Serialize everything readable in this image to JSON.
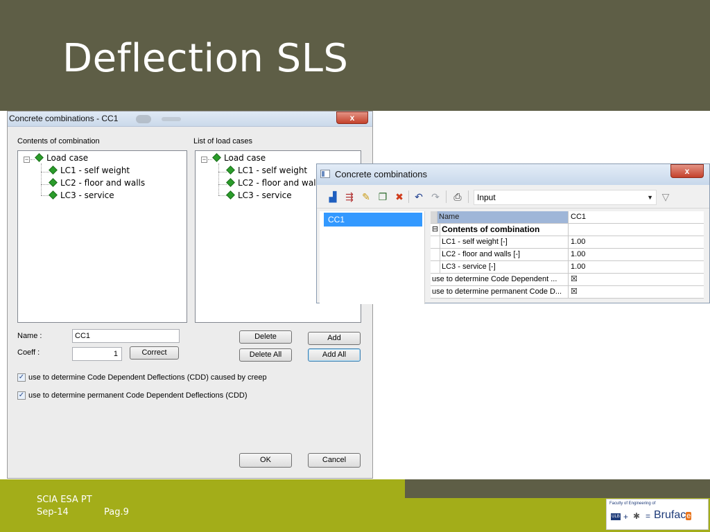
{
  "slide": {
    "title": "Deflection SLS",
    "colors": {
      "title_band": "#5e5e46",
      "footer_green": "#a3ad19",
      "selection_blue": "#3399ff",
      "diamond_green": "#2a9c2a"
    }
  },
  "dialog1": {
    "title": "Concrete combinations - CC1",
    "close_glyph": "x",
    "contents_label": "Contents of combination",
    "list_label": "List of load cases",
    "contents_tree": {
      "root": "Load case",
      "items": [
        "LC1 - self weight",
        "LC2 - floor and walls",
        "LC3 - service"
      ]
    },
    "list_tree": {
      "root": "Load case",
      "items": [
        "LC1 - self weight",
        "LC2 - floor and walls",
        "LC3 - service"
      ]
    },
    "name_label": "Name :",
    "name_value": "CC1",
    "coeff_label": "Coeff :",
    "coeff_value": "1",
    "buttons": {
      "correct": "Correct",
      "delete": "Delete",
      "delete_all": "Delete All",
      "add": "Add",
      "add_all": "Add All",
      "ok": "OK",
      "cancel": "Cancel"
    },
    "checkboxes": [
      {
        "label": "use to determine Code Dependent Deflections (CDD) caused by creep",
        "checked": true
      },
      {
        "label": "use to determine permanent Code Dependent Deflections (CDD)",
        "checked": true
      }
    ]
  },
  "dialog2": {
    "title": "Concrete combinations",
    "close_glyph": "x",
    "toolbar": {
      "icons": [
        "new-icon",
        "add-to-list-icon",
        "edit-icon",
        "copy-icon",
        "delete-icon",
        "undo-icon",
        "redo-icon",
        "print-icon"
      ],
      "select_value": "Input",
      "filter_icon": "filter-icon"
    },
    "list_items": [
      "CC1"
    ],
    "properties": [
      {
        "name": "Name",
        "value": "CC1",
        "type": "header"
      },
      {
        "name": "Contents of combination",
        "value": "",
        "type": "group"
      },
      {
        "name": "LC1 - self weight [-]",
        "value": "1.00",
        "type": "child"
      },
      {
        "name": "LC2 - floor and walls [-]",
        "value": "1.00",
        "type": "child"
      },
      {
        "name": "LC3 - service [-]",
        "value": "1.00",
        "type": "child"
      },
      {
        "name": "use to determine Code Dependent ...",
        "value": "☒",
        "type": "row"
      },
      {
        "name": "use to determine permanent Code D...",
        "value": "☒",
        "type": "row"
      }
    ]
  },
  "footer": {
    "line1": "SCIA ESA PT",
    "date": "Sep-14",
    "page": "Pag.9",
    "logo": {
      "faculty": "Faculty of Engineering of",
      "brand": "Brufac"
    }
  }
}
